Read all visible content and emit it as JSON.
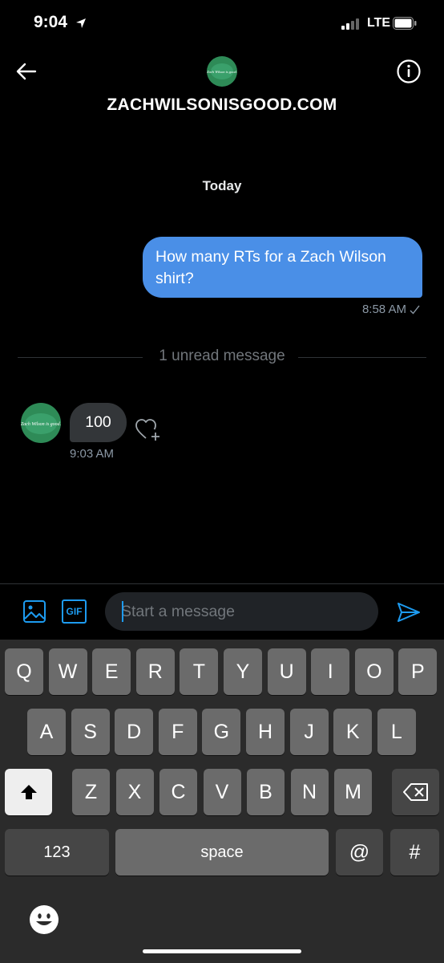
{
  "status_bar": {
    "time": "9:04",
    "network": "LTE"
  },
  "header": {
    "title": "ZACHWILSONISGOOD.COM",
    "avatar_text": "Zach Wilson is good."
  },
  "conversation": {
    "date_label": "Today",
    "sent": {
      "text": "How many RTs for a Zach Wilson shirt?",
      "time": "8:58 AM"
    },
    "unread_label": "1 unread message",
    "received": {
      "text": "100",
      "time": "9:03 AM"
    }
  },
  "composer": {
    "placeholder": "Start a message",
    "gif_label": "GIF"
  },
  "keyboard": {
    "row1": [
      "Q",
      "W",
      "E",
      "R",
      "T",
      "Y",
      "U",
      "I",
      "O",
      "P"
    ],
    "row2": [
      "A",
      "S",
      "D",
      "F",
      "G",
      "H",
      "J",
      "K",
      "L"
    ],
    "row3": [
      "Z",
      "X",
      "C",
      "V",
      "B",
      "N",
      "M"
    ],
    "numbers_label": "123",
    "space_label": "space",
    "at_label": "@",
    "hash_label": "#"
  },
  "icons": {
    "back": "back-arrow-icon",
    "info": "info-icon",
    "image": "image-icon",
    "gif": "gif-icon",
    "send": "send-icon",
    "heart": "heart-add-icon",
    "shift": "shift-icon",
    "delete": "backspace-icon",
    "emoji": "emoji-icon"
  },
  "colors": {
    "accent": "#1d9bf0",
    "sent_bubble": "#4a8fe7",
    "received_bubble": "#333639",
    "avatar_green": "#2e8b57"
  }
}
